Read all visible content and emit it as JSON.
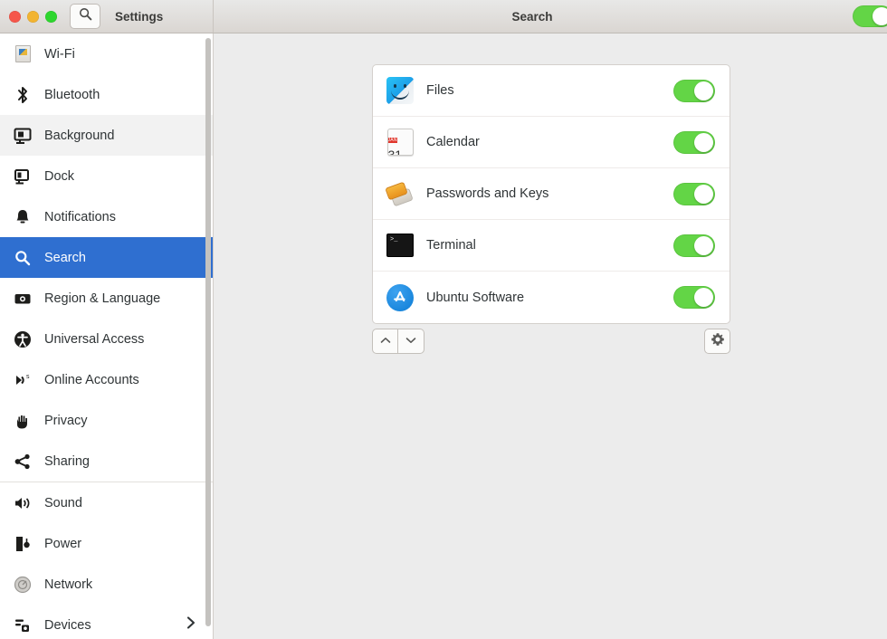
{
  "titlebar": {
    "window_title": "Settings",
    "search_button_icon": "search-icon",
    "panel_title": "Search",
    "lights": [
      "close",
      "minimize",
      "maximize"
    ],
    "master_toggle": {
      "state": "on",
      "color": "#63d546"
    }
  },
  "sidebar": {
    "items": [
      {
        "label": "Wi-Fi",
        "icon": "wifi-icon",
        "state": "normal"
      },
      {
        "label": "Bluetooth",
        "icon": "bluetooth-icon",
        "state": "normal"
      },
      {
        "label": "Background",
        "icon": "background-icon",
        "state": "hovered"
      },
      {
        "label": "Dock",
        "icon": "dock-icon",
        "state": "normal"
      },
      {
        "label": "Notifications",
        "icon": "bell-icon",
        "state": "normal"
      },
      {
        "label": "Search",
        "icon": "search-icon",
        "state": "selected"
      },
      {
        "label": "Region & Language",
        "icon": "region-language-icon",
        "state": "normal"
      },
      {
        "label": "Universal Access",
        "icon": "accessibility-icon",
        "state": "normal"
      },
      {
        "label": "Online Accounts",
        "icon": "online-accounts-icon",
        "state": "normal"
      },
      {
        "label": "Privacy",
        "icon": "privacy-hand-icon",
        "state": "normal"
      },
      {
        "label": "Sharing",
        "icon": "share-icon",
        "state": "normal"
      },
      {
        "label": "Sound",
        "icon": "speaker-icon",
        "state": "normal"
      },
      {
        "label": "Power",
        "icon": "power-plug-icon",
        "state": "normal"
      },
      {
        "label": "Network",
        "icon": "network-icon",
        "state": "normal"
      },
      {
        "label": "Devices",
        "icon": "devices-icon",
        "state": "normal",
        "chevron": "chevron-right-icon"
      }
    ],
    "separator_after": [
      "Sharing"
    ],
    "selected_color": "#2f6fd0",
    "hover_color": "#f2f2f2"
  },
  "main": {
    "apps": [
      {
        "name": "Files",
        "icon": "files-app-icon",
        "toggle": "on"
      },
      {
        "name": "Calendar",
        "icon": "calendar-app-icon",
        "toggle": "on",
        "calendar_month": "JAN",
        "calendar_day": "31"
      },
      {
        "name": "Passwords and Keys",
        "icon": "passwords-keys-app-icon",
        "toggle": "on"
      },
      {
        "name": "Terminal",
        "icon": "terminal-app-icon",
        "toggle": "on"
      },
      {
        "name": "Ubuntu Software",
        "icon": "ubuntu-software-app-icon",
        "toggle": "on"
      }
    ],
    "toolbar": {
      "move_up_icon": "chevron-up-icon",
      "move_down_icon": "chevron-down-icon",
      "settings_icon": "gear-icon"
    },
    "toggle_on_color": "#63d546"
  }
}
